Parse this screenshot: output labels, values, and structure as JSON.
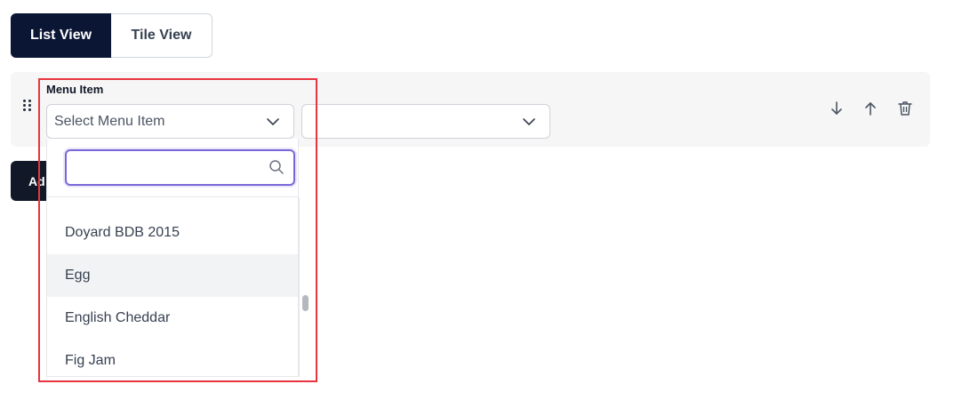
{
  "view_toggle": {
    "list": "List View",
    "tile": "Tile View",
    "active": "List View"
  },
  "row": {
    "field_label": "Menu Item",
    "menu_select": {
      "value": "Select Menu Item"
    },
    "second_select": {
      "value": ""
    }
  },
  "add_button": {
    "label": "Ad"
  },
  "dropdown": {
    "search_placeholder": "",
    "options": [
      {
        "label": "Doyard BDB 2015"
      },
      {
        "label": "Egg",
        "hovered": true
      },
      {
        "label": "English Cheddar"
      },
      {
        "label": "Fig Jam"
      }
    ]
  },
  "colors": {
    "primary": "#0b1634",
    "focus": "#7b66d9",
    "highlight_box": "#e8343e"
  },
  "icons": [
    "drag-handle-icon",
    "chevron-down-icon",
    "arrow-down-icon",
    "arrow-up-icon",
    "trash-icon",
    "search-icon"
  ]
}
